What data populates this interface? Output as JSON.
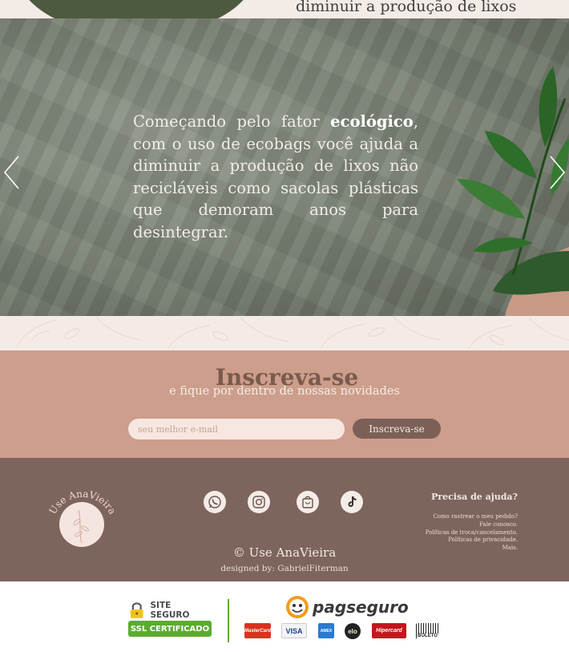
{
  "top_strip": {
    "text": "diminuir a produção de lixos"
  },
  "hero": {
    "text_before": "Começando pelo fator ",
    "text_bold": "ecológico",
    "text_after": ", com o uso de ecobags você ajuda a diminuir a produção de lixos não recicláveis como sacolas plásticas que demoram anos para desintegrar.",
    "prev_icon": "chevron-left-icon",
    "next_icon": "chevron-right-icon"
  },
  "newsletter": {
    "title": "Inscreva-se",
    "subtitle": "e fique por dentro de nossas novidades",
    "email_placeholder": "seu melhor e-mail",
    "button_label": "Inscreva-se"
  },
  "footer": {
    "logo_text": "Use AnaVieira",
    "social": [
      "whatsapp-icon",
      "instagram-icon",
      "shopping-bag-icon",
      "tiktok-icon"
    ],
    "copyright": "© Use AnaVieira",
    "designer": "designed by: GabrielFiterman",
    "help_title": "Precisa de ajuda?",
    "help_links": [
      "Como rastrear o meu pedido?",
      "Fale conosco.",
      "Políticas de troca/cancelamento.",
      "Políticas de privacidade.",
      "Mais."
    ]
  },
  "trust": {
    "ssl_top": "SITE SEGURO",
    "ssl_bottom": "SSL CERTIFICADO",
    "pagseguro": "pagseguro",
    "cards": [
      "MasterCard",
      "VISA",
      "AMEX",
      "elo",
      "Hipercard",
      "BOLETO"
    ]
  },
  "colors": {
    "newsletter_bg": "#cc9e8b",
    "footer_bg": "#7d645c",
    "accent_green": "#5bab32",
    "button_bg": "#7c6058"
  }
}
